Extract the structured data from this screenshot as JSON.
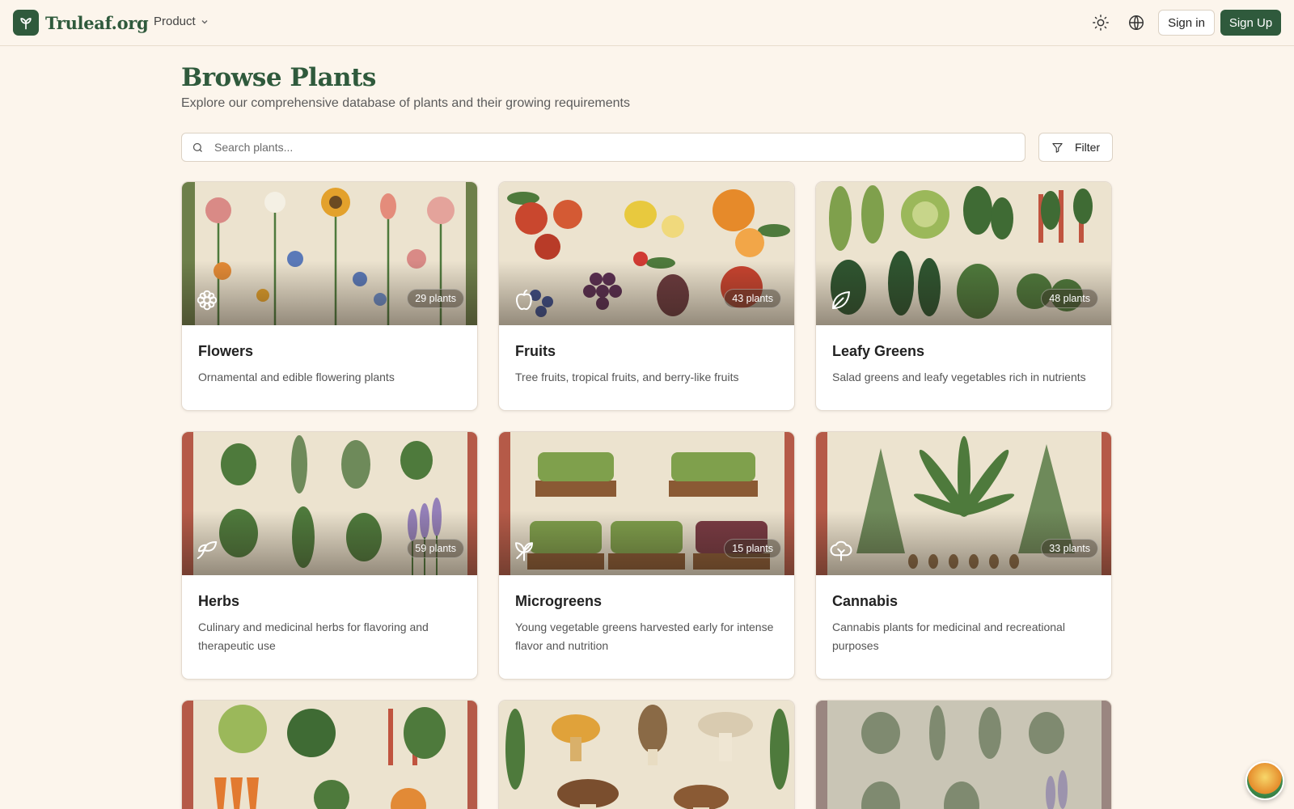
{
  "header": {
    "brand": "Truleaf.org",
    "product_menu": "Product",
    "sign_in": "Sign in",
    "sign_up": "Sign Up"
  },
  "page": {
    "title": "Browse Plants",
    "subtitle": "Explore our comprehensive database of plants and their growing requirements"
  },
  "search": {
    "placeholder": "Search plants...",
    "value": ""
  },
  "filter": {
    "label": "Filter"
  },
  "colors": {
    "brand": "#2f5a3c",
    "background": "#fcf5ec",
    "card": "#ffffff"
  },
  "categories": [
    {
      "title": "Flowers",
      "description": "Ornamental and edible flowering plants",
      "count": "29 plants",
      "icon": "flower-icon"
    },
    {
      "title": "Fruits",
      "description": "Tree fruits, tropical fruits, and berry-like fruits",
      "count": "43 plants",
      "icon": "apple-icon"
    },
    {
      "title": "Leafy Greens",
      "description": "Salad greens and leafy vegetables rich in nutrients",
      "count": "48 plants",
      "icon": "leaf-icon"
    },
    {
      "title": "Herbs",
      "description": "Culinary and medicinal herbs for flavoring and therapeutic use",
      "count": "59 plants",
      "icon": "sprout-icon"
    },
    {
      "title": "Microgreens",
      "description": "Young vegetable greens harvested early for intense flavor and nutrition",
      "count": "15 plants",
      "icon": "seedling-icon"
    },
    {
      "title": "Cannabis",
      "description": "Cannabis plants for medicinal and recreational purposes",
      "count": "33 plants",
      "icon": "tree-icon"
    }
  ]
}
